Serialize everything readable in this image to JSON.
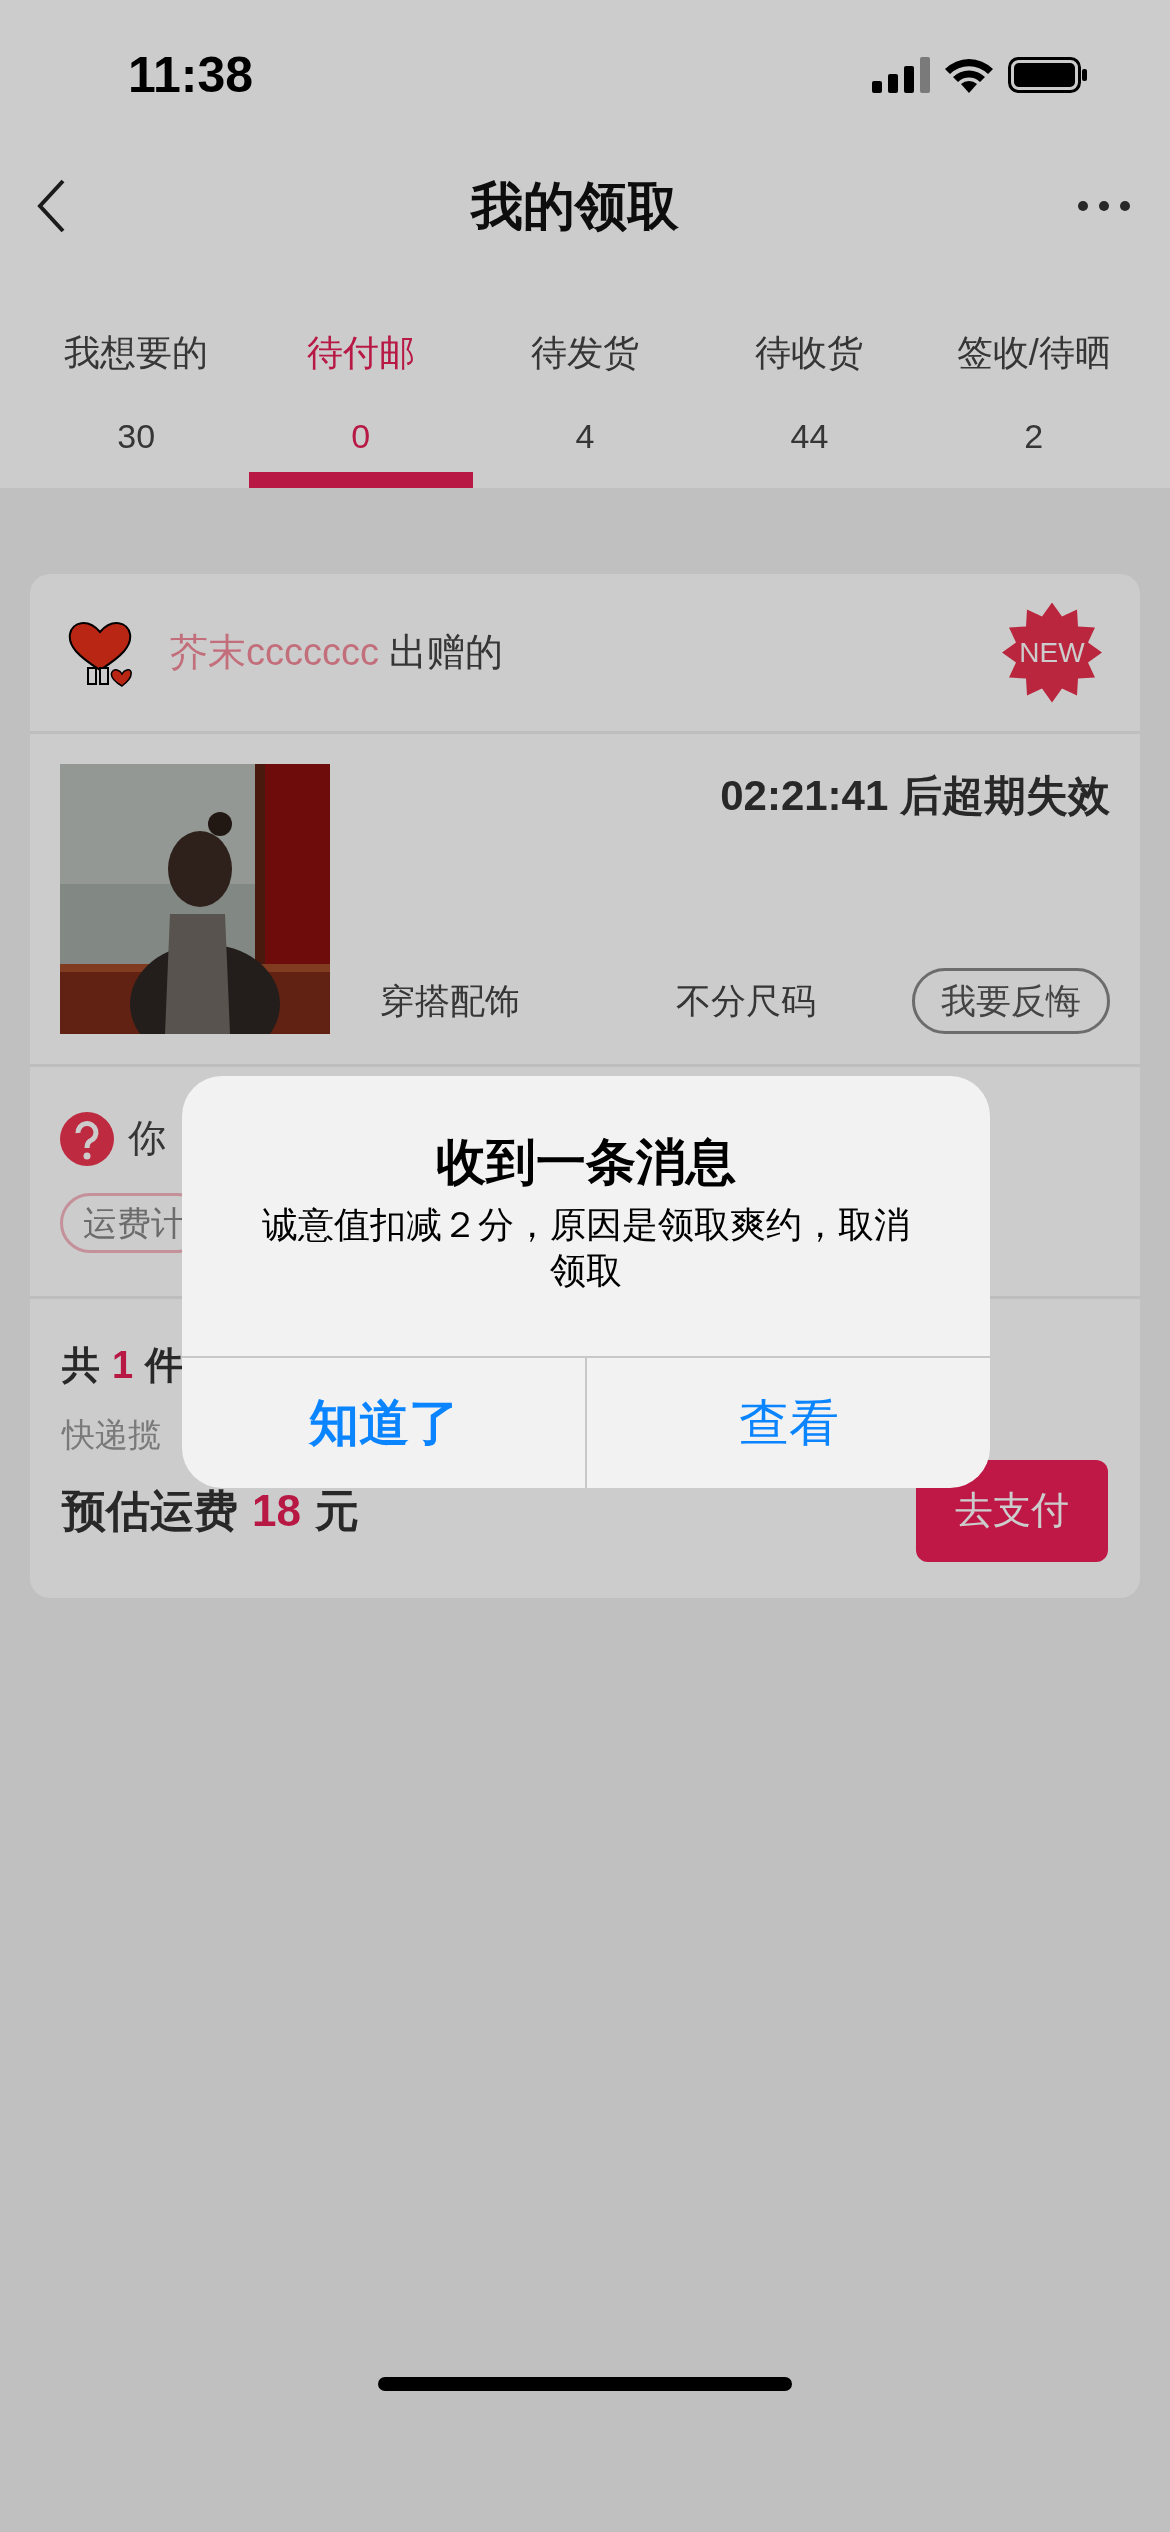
{
  "status_bar": {
    "time": "11:38"
  },
  "nav": {
    "title": "我的领取"
  },
  "tabs": [
    {
      "label": "我想要的",
      "count": "30",
      "selected": false
    },
    {
      "label": "待付邮",
      "count": "0",
      "selected": true
    },
    {
      "label": "待发货",
      "count": "4",
      "selected": false
    },
    {
      "label": "待收货",
      "count": "44",
      "selected": false
    },
    {
      "label": "签收/待晒",
      "count": "2",
      "selected": false
    }
  ],
  "card": {
    "giver": "芥末ccccccc",
    "giver_suffix": "出赠的",
    "badge": "NEW",
    "countdown": "02:21:41 后超期失效",
    "category": "穿搭配饰",
    "size": "不分尺码",
    "regret_button": "我要反悔",
    "question": "你",
    "tag": "运费计",
    "total_prefix": "共",
    "total_count": "1",
    "total_suffix": "件",
    "courier": "快递揽",
    "fee_label": "预估运费",
    "fee_amount": "18",
    "fee_unit": "元",
    "pay_button": "去支付"
  },
  "dialog": {
    "title": "收到一条消息",
    "message": "诚意值扣减２分，原因是领取爽约，取消领取",
    "buttons": [
      {
        "label": "知道了",
        "kind": "primary"
      },
      {
        "label": "查看",
        "kind": "default"
      }
    ]
  }
}
